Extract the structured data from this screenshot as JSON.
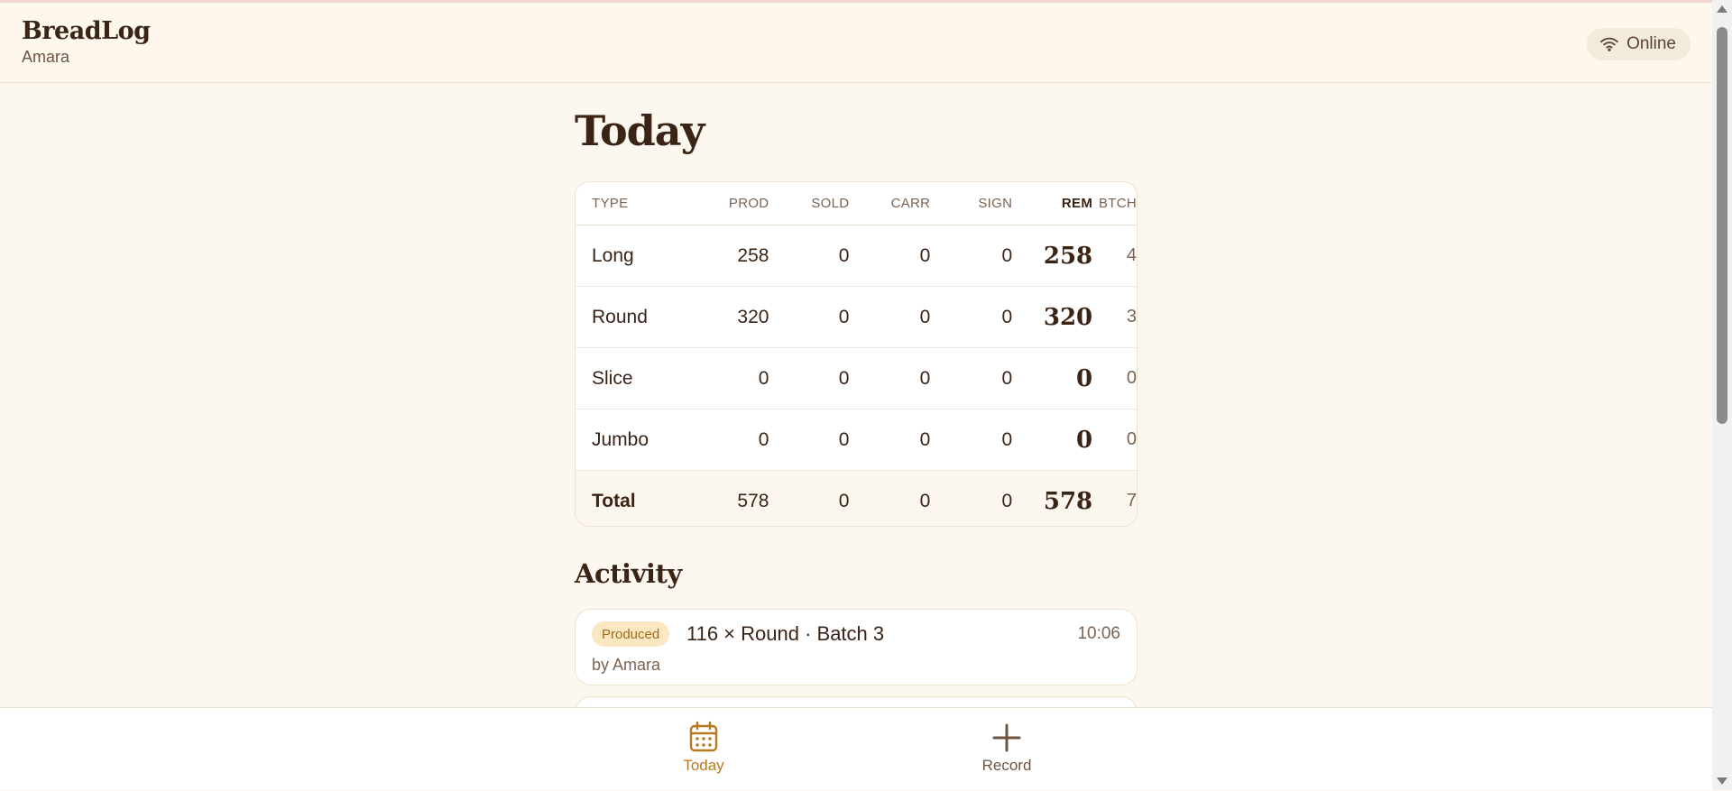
{
  "app": {
    "name": "BreadLog",
    "user": "Amara"
  },
  "status": {
    "label": "Online",
    "icon": "wifi-icon"
  },
  "page": {
    "title": "Today"
  },
  "table": {
    "headers": {
      "type": "TYPE",
      "prod": "PROD",
      "sold": "SOLD",
      "carr": "CARR",
      "sign": "SIGN",
      "rem": "REM",
      "btch": "BTCH"
    },
    "rows": [
      {
        "type": "Long",
        "prod": "258",
        "sold": "0",
        "carr": "0",
        "sign": "0",
        "rem": "258",
        "btch": "4"
      },
      {
        "type": "Round",
        "prod": "320",
        "sold": "0",
        "carr": "0",
        "sign": "0",
        "rem": "320",
        "btch": "3"
      },
      {
        "type": "Slice",
        "prod": "0",
        "sold": "0",
        "carr": "0",
        "sign": "0",
        "rem": "0",
        "btch": "0"
      },
      {
        "type": "Jumbo",
        "prod": "0",
        "sold": "0",
        "carr": "0",
        "sign": "0",
        "rem": "0",
        "btch": "0"
      }
    ],
    "total": {
      "type": "Total",
      "prod": "578",
      "sold": "0",
      "carr": "0",
      "sign": "0",
      "rem": "578",
      "btch": "7"
    }
  },
  "activity": {
    "title": "Activity",
    "items": [
      {
        "badge": "Produced",
        "title": "116 × Round · Batch 3",
        "time": "10:06",
        "by": "by Amara"
      }
    ]
  },
  "nav": {
    "today": {
      "label": "Today",
      "icon": "calendar-icon"
    },
    "record": {
      "label": "Record",
      "icon": "plus-icon"
    }
  },
  "colors": {
    "background": "#fcf7ef",
    "accent": "#b7791f",
    "text": "#3a2416",
    "badge_bg": "#fbe8c3"
  }
}
